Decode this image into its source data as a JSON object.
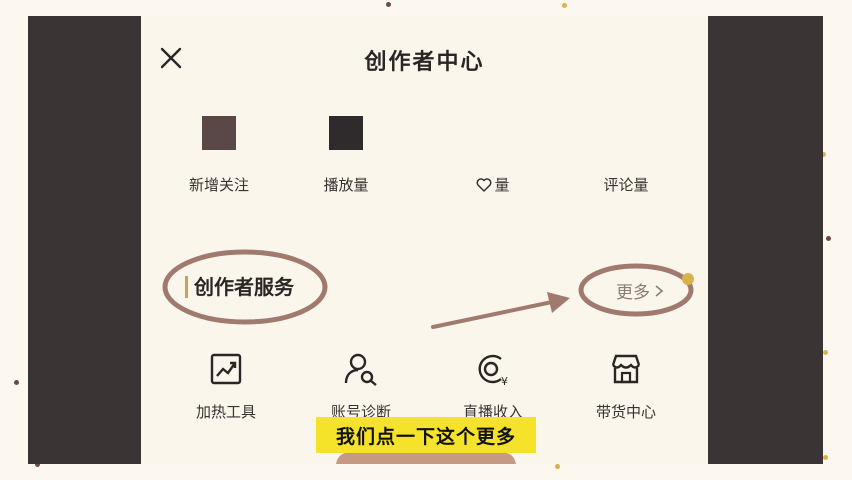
{
  "header": {
    "title": "创作者中心",
    "close_icon": "close-icon"
  },
  "stats": [
    {
      "label": "新增关注",
      "icon": null
    },
    {
      "label": "播放量",
      "icon": null
    },
    {
      "label": "量",
      "icon": "heart-icon"
    },
    {
      "label": "评论量",
      "icon": null
    }
  ],
  "services_section": {
    "title": "创作者服务",
    "more_label": "更多"
  },
  "services": [
    {
      "label": "加热工具",
      "icon": "trend-chart-icon"
    },
    {
      "label": "账号诊断",
      "icon": "user-search-icon"
    },
    {
      "label": "直播收入",
      "icon": "live-income-icon"
    },
    {
      "label": "带货中心",
      "icon": "store-icon"
    }
  ],
  "caption": "我们点一下这个更多",
  "colors": {
    "background": "#fdf8ef",
    "dark_panel": "#3b3435",
    "phone_bg": "#fbf6ec",
    "annotation": "#a07a6e",
    "caption_bg": "#f5e22a"
  }
}
